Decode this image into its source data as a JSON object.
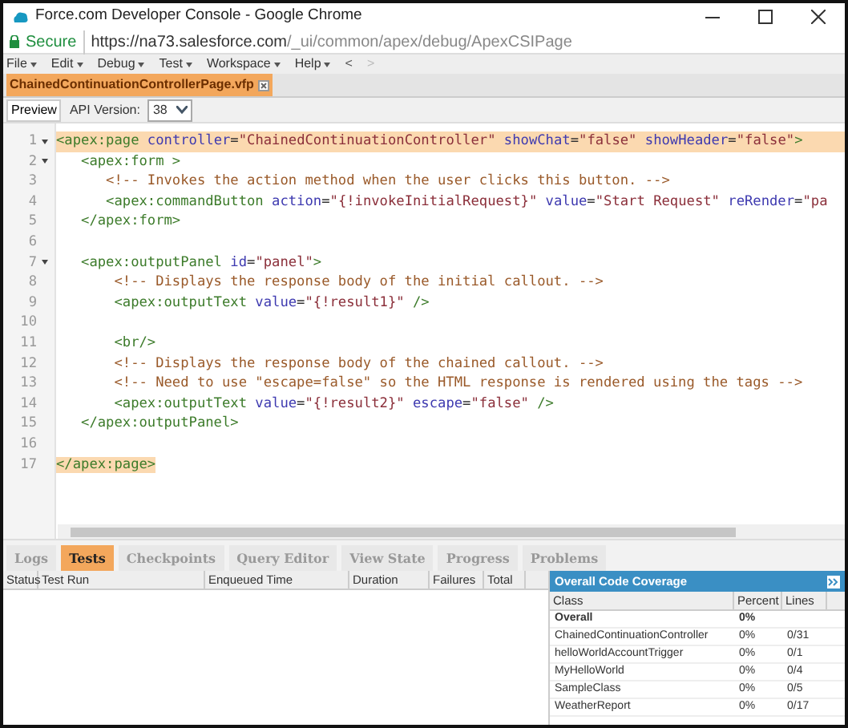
{
  "window": {
    "title": "Force.com Developer Console - Google Chrome"
  },
  "address_bar": {
    "security": "Secure",
    "url_host": "https://na73.salesforce.com",
    "url_path": "/_ui/common/apex/debug/ApexCSIPage"
  },
  "menu": [
    {
      "label": "File"
    },
    {
      "label": "Edit"
    },
    {
      "label": "Debug"
    },
    {
      "label": "Test"
    },
    {
      "label": "Workspace"
    },
    {
      "label": "Help"
    }
  ],
  "nav": [
    {
      "label": "<",
      "disabled": false
    },
    {
      "label": ">",
      "disabled": true
    }
  ],
  "file_tabs": [
    {
      "label": "ChainedContinuationControllerPage.vfp",
      "selected": true
    }
  ],
  "toolbar": {
    "preview": "Preview",
    "api_label": "API Version:",
    "api_value": "38"
  },
  "code_lines": [
    {
      "number": "1",
      "foldable": true,
      "highlighted": true,
      "tokens": [
        {
          "kind": "tag",
          "text": "<apex:page"
        },
        {
          "kind": "attr",
          "text": " controller"
        },
        {
          "kind": "text",
          "text": "="
        },
        {
          "kind": "str",
          "text": "\"ChainedContinuationController\""
        },
        {
          "kind": "attr",
          "text": " showChat"
        },
        {
          "kind": "text",
          "text": "="
        },
        {
          "kind": "str",
          "text": "\"false\""
        },
        {
          "kind": "attr",
          "text": " showHeader"
        },
        {
          "kind": "text",
          "text": "="
        },
        {
          "kind": "str",
          "text": "\"false\""
        },
        {
          "kind": "tag",
          "text": ">"
        }
      ]
    },
    {
      "number": "2",
      "foldable": true,
      "highlighted": false,
      "tokens": [
        {
          "kind": "tag",
          "text": "   <apex:form >"
        }
      ]
    },
    {
      "number": "3",
      "foldable": false,
      "highlighted": false,
      "tokens": [
        {
          "kind": "comment",
          "text": "      <!-- Invokes the action method when the user clicks this button. -->"
        }
      ]
    },
    {
      "number": "4",
      "foldable": false,
      "highlighted": false,
      "tokens": [
        {
          "kind": "tag",
          "text": "      <apex:commandButton"
        },
        {
          "kind": "attr",
          "text": " action"
        },
        {
          "kind": "text",
          "text": "="
        },
        {
          "kind": "str",
          "text": "\"{!invokeInitialRequest}\""
        },
        {
          "kind": "attr",
          "text": " value"
        },
        {
          "kind": "text",
          "text": "="
        },
        {
          "kind": "str",
          "text": "\"Start Request\""
        },
        {
          "kind": "attr",
          "text": " reRender"
        },
        {
          "kind": "text",
          "text": "="
        },
        {
          "kind": "str",
          "text": "\"pa"
        }
      ]
    },
    {
      "number": "5",
      "foldable": false,
      "highlighted": false,
      "tokens": [
        {
          "kind": "tag",
          "text": "   </apex:form>"
        }
      ]
    },
    {
      "number": "6",
      "foldable": false,
      "highlighted": false
    },
    {
      "number": "7",
      "foldable": true,
      "highlighted": false,
      "tokens": [
        {
          "kind": "tag",
          "text": "   <apex:outputPanel"
        },
        {
          "kind": "attr",
          "text": " id"
        },
        {
          "kind": "text",
          "text": "="
        },
        {
          "kind": "str",
          "text": "\"panel\""
        },
        {
          "kind": "tag",
          "text": ">"
        }
      ]
    },
    {
      "number": "8",
      "foldable": false,
      "highlighted": false,
      "tokens": [
        {
          "kind": "comment",
          "text": "       <!-- Displays the response body of the initial callout. -->"
        }
      ]
    },
    {
      "number": "9",
      "foldable": false,
      "highlighted": false,
      "tokens": [
        {
          "kind": "tag",
          "text": "       <apex:outputText"
        },
        {
          "kind": "attr",
          "text": " value"
        },
        {
          "kind": "text",
          "text": "="
        },
        {
          "kind": "str",
          "text": "\"{!result1}\""
        },
        {
          "kind": "tag",
          "text": " />"
        }
      ]
    },
    {
      "number": "10",
      "foldable": false,
      "highlighted": false
    },
    {
      "number": "11",
      "foldable": false,
      "highlighted": false,
      "tokens": [
        {
          "kind": "tag",
          "text": "       <br/>"
        }
      ]
    },
    {
      "number": "12",
      "foldable": false,
      "highlighted": false,
      "tokens": [
        {
          "kind": "comment",
          "text": "       <!-- Displays the response body of the chained callout. -->"
        }
      ]
    },
    {
      "number": "13",
      "foldable": false,
      "highlighted": false,
      "tokens": [
        {
          "kind": "comment",
          "text": "       <!-- Need to use \"escape=false\" so the HTML response is rendered using the tags -->"
        }
      ]
    },
    {
      "number": "14",
      "foldable": false,
      "highlighted": false,
      "tokens": [
        {
          "kind": "tag",
          "text": "       <apex:outputText"
        },
        {
          "kind": "attr",
          "text": " value"
        },
        {
          "kind": "text",
          "text": "="
        },
        {
          "kind": "str",
          "text": "\"{!result2}\""
        },
        {
          "kind": "attr",
          "text": " escape"
        },
        {
          "kind": "text",
          "text": "="
        },
        {
          "kind": "str",
          "text": "\"false\""
        },
        {
          "kind": "tag",
          "text": " />"
        }
      ]
    },
    {
      "number": "15",
      "foldable": false,
      "highlighted": false,
      "tokens": [
        {
          "kind": "tag",
          "text": "   </apex:outputPanel>"
        }
      ]
    },
    {
      "number": "16",
      "foldable": false,
      "highlighted": false
    },
    {
      "number": "17",
      "foldable": false,
      "highlighted": false,
      "tokens": [
        {
          "kind": "tag",
          "text": "</apex:page>",
          "matched": true
        }
      ]
    }
  ],
  "bottom_tabs": [
    {
      "label": "Logs",
      "selected": false
    },
    {
      "label": "Tests",
      "selected": true
    },
    {
      "label": "Checkpoints",
      "selected": false
    },
    {
      "label": "Query Editor",
      "selected": false
    },
    {
      "label": "View State",
      "selected": false
    },
    {
      "label": "Progress",
      "selected": false
    },
    {
      "label": "Problems",
      "selected": false
    }
  ],
  "tests_table": {
    "columns": [
      "Status",
      "Test Run",
      "Enqueued Time",
      "Duration",
      "Failures",
      "Total"
    ]
  },
  "coverage": {
    "title": "Overall Code Coverage",
    "columns": [
      "Class",
      "Percent",
      "Lines"
    ],
    "rows": [
      {
        "kind": "total",
        "class": "Overall",
        "percent": "0%"
      },
      {
        "kind": "class",
        "class": "ChainedContinuationController",
        "percent": "0%",
        "lines": "0/31"
      },
      {
        "kind": "class",
        "class": "helloWorldAccountTrigger",
        "percent": "0%",
        "lines": "0/1"
      },
      {
        "kind": "class",
        "class": "MyHelloWorld",
        "percent": "0%",
        "lines": "0/4"
      },
      {
        "kind": "class",
        "class": "SampleClass",
        "percent": "0%",
        "lines": "0/5"
      },
      {
        "kind": "class",
        "class": "WeatherReport",
        "percent": "0%",
        "lines": "0/17"
      }
    ]
  }
}
